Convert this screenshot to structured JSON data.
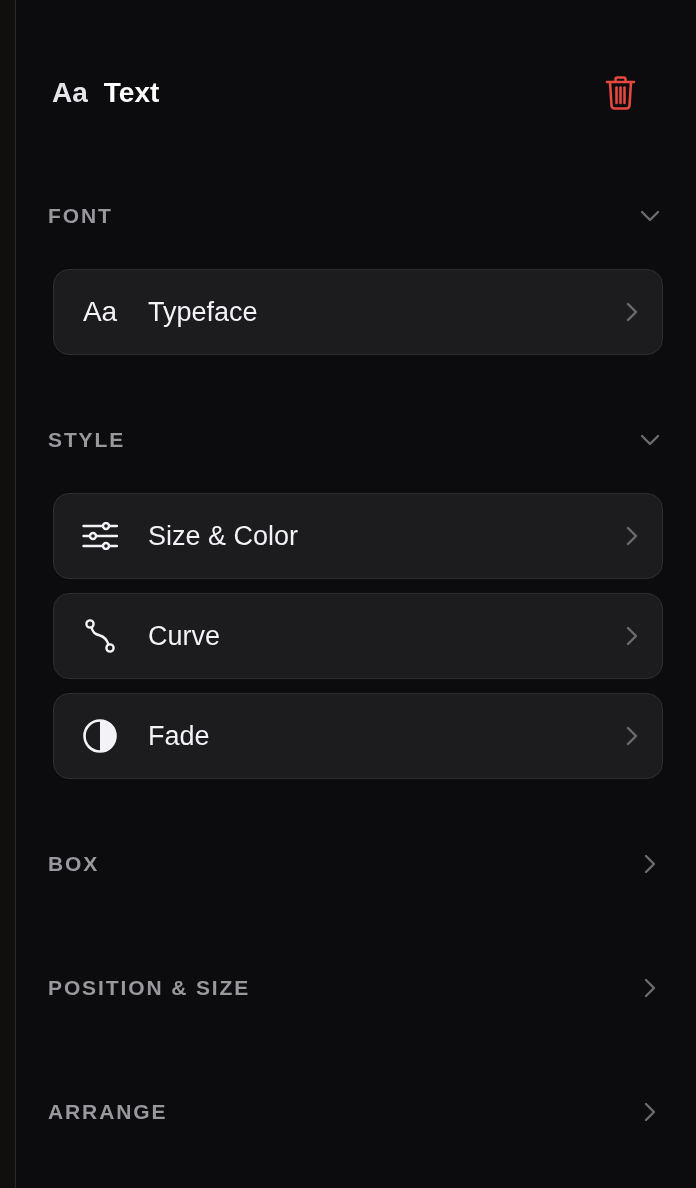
{
  "header": {
    "glyph": "Aa",
    "title": "Text"
  },
  "sections": [
    {
      "title": "FONT",
      "expanded": true,
      "items": [
        {
          "kind": "glyph",
          "glyph": "Aa",
          "label": "Typeface"
        }
      ]
    },
    {
      "title": "STYLE",
      "expanded": true,
      "items": [
        {
          "kind": "sliders",
          "label": "Size & Color"
        },
        {
          "kind": "curve",
          "label": "Curve"
        },
        {
          "kind": "contrast",
          "label": "Fade"
        }
      ]
    },
    {
      "title": "BOX",
      "expanded": false
    },
    {
      "title": "POSITION & SIZE",
      "expanded": false
    },
    {
      "title": "ARRANGE",
      "expanded": false
    }
  ]
}
